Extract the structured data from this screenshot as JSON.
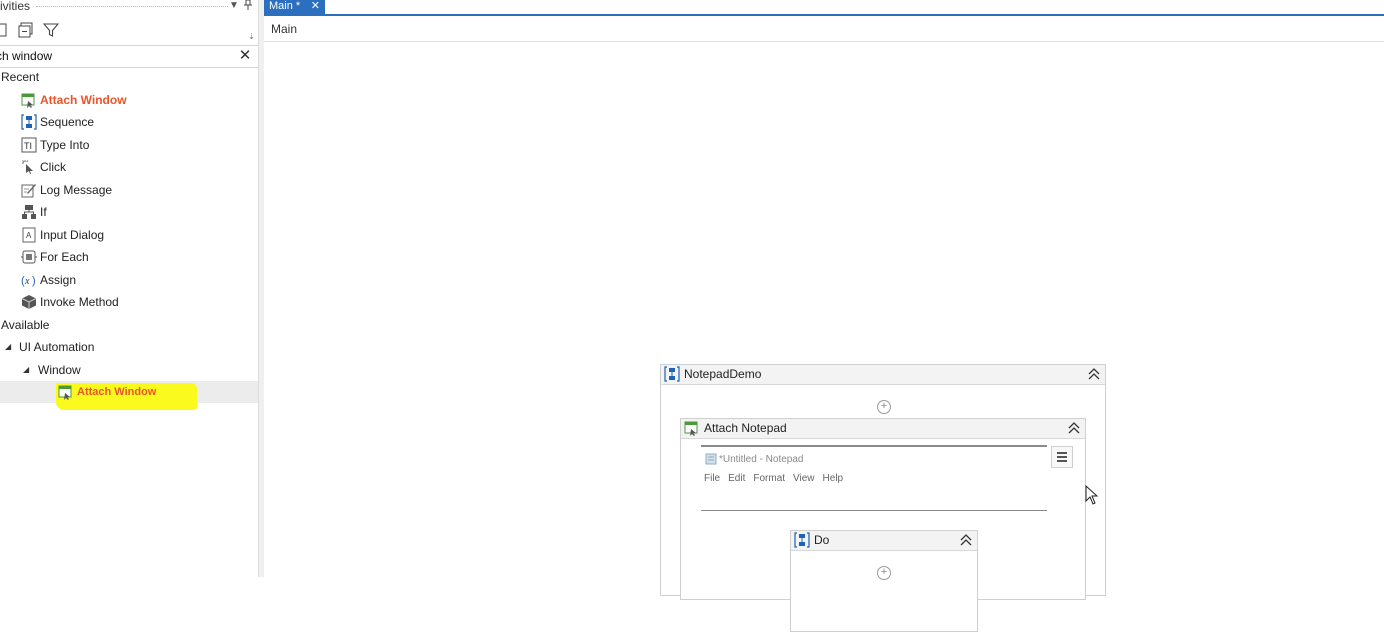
{
  "activities_panel": {
    "title": "ivities",
    "search": {
      "value": "ch window",
      "placeholder": ""
    },
    "recent_header": "Recent",
    "recent_items": [
      {
        "label": "Attach Window",
        "icon": "attach-window-icon",
        "highlight": true
      },
      {
        "label": "Sequence",
        "icon": "sequence-icon"
      },
      {
        "label": "Type Into",
        "icon": "type-into-icon"
      },
      {
        "label": "Click",
        "icon": "click-icon"
      },
      {
        "label": "Log Message",
        "icon": "log-message-icon"
      },
      {
        "label": "If",
        "icon": "if-icon"
      },
      {
        "label": "Input Dialog",
        "icon": "input-dialog-icon"
      },
      {
        "label": "For Each",
        "icon": "for-each-icon"
      },
      {
        "label": "Assign",
        "icon": "assign-icon"
      },
      {
        "label": "Invoke Method",
        "icon": "invoke-method-icon"
      }
    ],
    "available_header": "Available",
    "ui_automation": "UI Automation",
    "window": "Window",
    "available_item": "Attach Window"
  },
  "tabs": [
    {
      "label": "Main *",
      "close": "✕",
      "active": true
    }
  ],
  "breadcrumb": "Main",
  "designer": {
    "sequence_title": "NotepadDemo",
    "attach_title": "Attach Notepad",
    "notepad_window_title": "*Untitled - Notepad",
    "notepad_menu": [
      "File",
      "Edit",
      "Format",
      "View",
      "Help"
    ],
    "do_title": "Do"
  },
  "colors": {
    "accent": "#2c6fbf",
    "orange_label": "#e8562a",
    "highlight": "#fafa1e",
    "sequence_icon_blue": "#1f63b5",
    "attach_icon_green": "#4a9a3a"
  }
}
